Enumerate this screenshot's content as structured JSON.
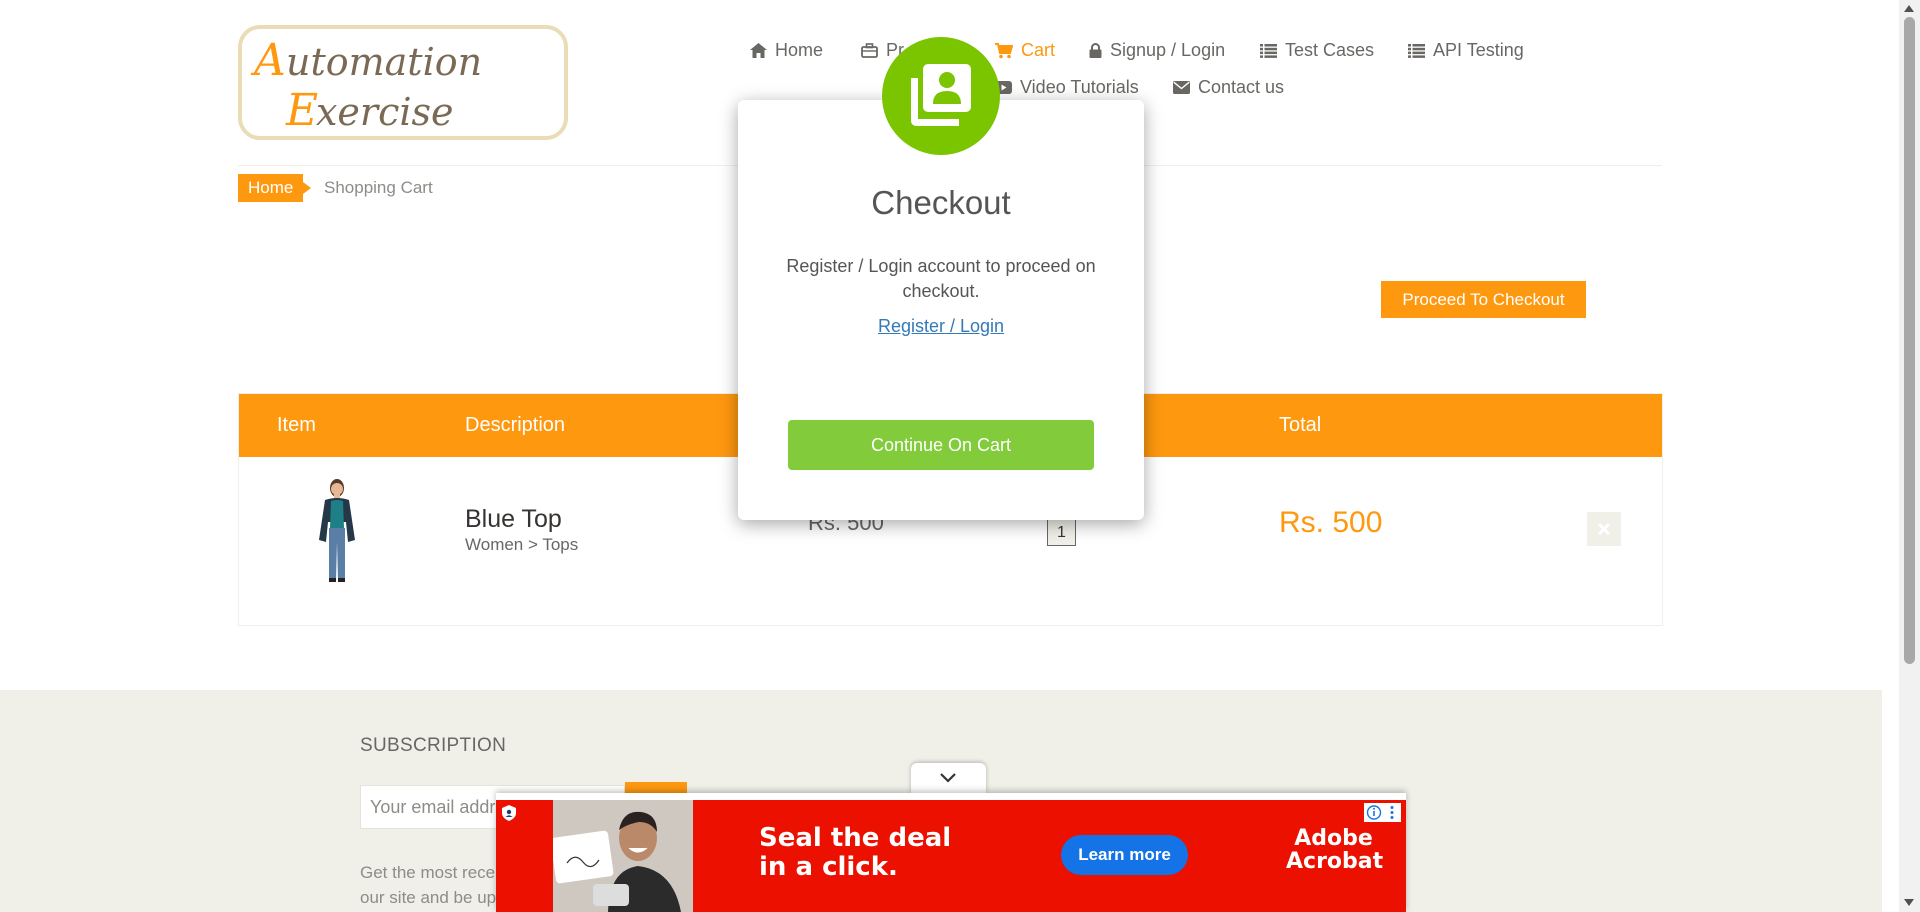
{
  "logo": {
    "text_line1": "Automation",
    "text_line2": "Exercise"
  },
  "nav": {
    "items": [
      {
        "label": "Home",
        "icon": "home-icon"
      },
      {
        "label": "Pr",
        "icon": "briefcase-icon"
      },
      {
        "label": "Cart",
        "icon": "cart-icon",
        "active": true
      },
      {
        "label": "Signup / Login",
        "icon": "lock-icon"
      },
      {
        "label": "Test Cases",
        "icon": "list-icon"
      },
      {
        "label": "API Testing",
        "icon": "list-icon"
      },
      {
        "label": "Video Tutorials",
        "icon": "youtube-icon"
      },
      {
        "label": "Contact us",
        "icon": "envelope-icon"
      }
    ]
  },
  "breadcrumb": {
    "home": "Home",
    "current": "Shopping Cart"
  },
  "proceed_button": "Proceed To Checkout",
  "cart": {
    "headers": {
      "item": "Item",
      "description": "Description",
      "total": "Total"
    },
    "rows": [
      {
        "name": "Blue Top",
        "category": "Women > Tops",
        "price": "Rs. 500",
        "quantity": "1",
        "total": "Rs. 500"
      }
    ]
  },
  "footer": {
    "subscription_title": "SUBSCRIPTION",
    "email_placeholder": "Your email addre",
    "text_line1": "Get the most rece",
    "text_line2": "our site and be up"
  },
  "modal": {
    "title": "Checkout",
    "body": "Register / Login account to proceed on checkout.",
    "link": "Register / Login",
    "button": "Continue On Cart"
  },
  "ad": {
    "headline_line1": "Seal the deal",
    "headline_line2": "in a click.",
    "cta": "Learn more",
    "brand_line1": "Adobe",
    "brand_line2": "Acrobat"
  },
  "colors": {
    "accent": "#fe980f",
    "modal_green": "#7ac400",
    "button_green": "#82cc3b",
    "ad_red": "#eb1000",
    "ad_cta": "#1473e6"
  }
}
